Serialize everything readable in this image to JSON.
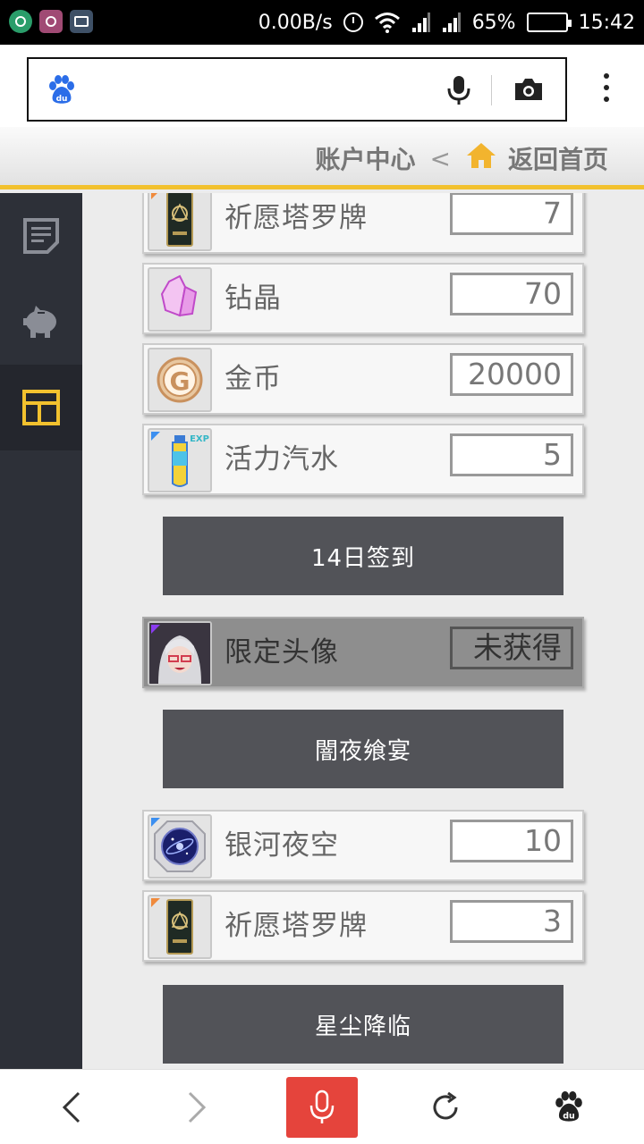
{
  "status_bar": {
    "net_speed": "0.00B/s",
    "battery_percent": "65%",
    "battery_level": 0.65,
    "time": "15:42",
    "left_icons": [
      "chat-app-icon",
      "camera-app-icon",
      "gallery-app-icon"
    ]
  },
  "browser": {
    "logo_icon": "baidu-paw-icon",
    "search_value": "",
    "actions": [
      "microphone-icon",
      "camera-icon",
      "more-menu-icon"
    ]
  },
  "page_header": {
    "account_center": "账户中心",
    "chevron": "<",
    "home_icon": "home-icon",
    "back_home": "返回首页",
    "accent_color": "#f2c12e"
  },
  "sidebar": {
    "items": [
      {
        "icon": "document-icon",
        "active": false
      },
      {
        "icon": "piggy-bank-icon",
        "active": false
      },
      {
        "icon": "layout-icon",
        "active": true
      }
    ]
  },
  "rewards": [
    {
      "icon": "tarot-card-icon",
      "name": "祈愿塔罗牌",
      "qty": "7"
    },
    {
      "icon": "crystal-icon",
      "name": "钻晶",
      "qty": "70"
    },
    {
      "icon": "gold-coin-icon",
      "name": "金币",
      "qty": "20000"
    },
    {
      "icon": "energy-drink-icon",
      "name": "活力汽水",
      "qty": "5",
      "badge": "EXP"
    },
    {
      "button": "14日签到"
    },
    {
      "icon": "avatar-portrait-icon",
      "name": "限定头像",
      "qty": "未获得"
    },
    {
      "button": "闇夜飨宴"
    },
    {
      "icon": "galaxy-orb-icon",
      "name": "银河夜空",
      "qty": "10"
    },
    {
      "icon": "tarot-card-icon",
      "name": "祈愿塔罗牌",
      "qty": "3"
    },
    {
      "button": "星尘降临"
    }
  ],
  "bottom_nav": {
    "items": [
      "back-icon",
      "forward-icon",
      "voice-search-icon",
      "refresh-icon",
      "baidu-home-icon"
    ]
  }
}
